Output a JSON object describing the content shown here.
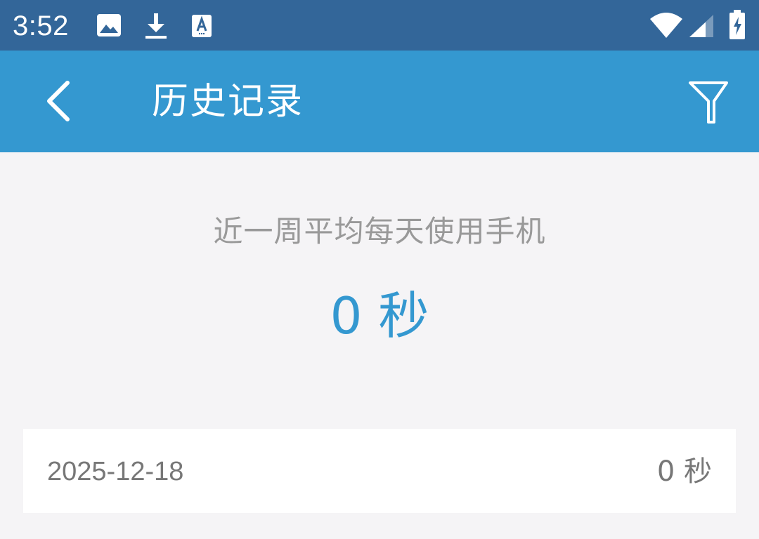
{
  "status_bar": {
    "time": "3:52",
    "icons": [
      "image-icon",
      "download-icon",
      "keyboard-a-icon",
      "wifi-icon",
      "signal-icon",
      "battery-charging-icon"
    ]
  },
  "app_bar": {
    "title": "历史记录",
    "back_icon": "chevron-left-icon",
    "filter_icon": "filter-icon",
    "background_color": "#3498d0"
  },
  "summary": {
    "label": "近一周平均每天使用手机",
    "value": "0 秒",
    "value_color": "#3498d0"
  },
  "records": [
    {
      "date": "2025-12-18",
      "duration": "0 秒"
    }
  ]
}
